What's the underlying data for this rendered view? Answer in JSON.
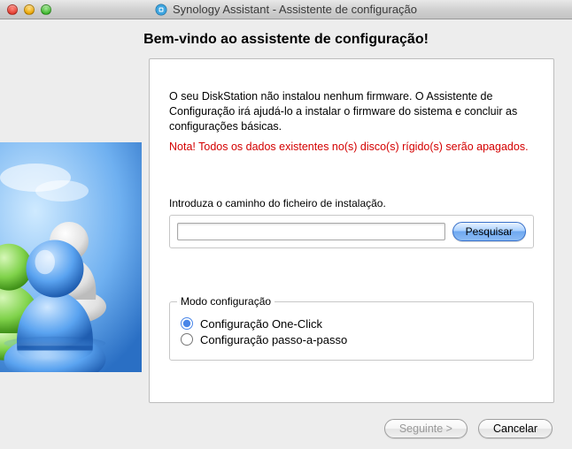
{
  "window": {
    "title": "Synology Assistant - Assistente de configuração"
  },
  "heading": "Bem-vindo ao assistente de configuração!",
  "content": {
    "intro": "O seu DiskStation não instalou nenhum firmware. O Assistente de Configuração irá ajudá-lo a instalar o firmware do sistema e concluir as configurações básicas.",
    "warning": "Nota! Todos os dados existentes no(s) disco(s) rígido(s) serão apagados.",
    "path_label": "Introduza o caminho do ficheiro de instalação.",
    "path_value": "",
    "browse_label": "Pesquisar"
  },
  "mode": {
    "legend": "Modo configuração",
    "options": [
      {
        "label": "Configuração One-Click",
        "selected": true
      },
      {
        "label": "Configuração passo-a-passo",
        "selected": false
      }
    ]
  },
  "footer": {
    "next": "Seguinte >",
    "cancel": "Cancelar"
  }
}
